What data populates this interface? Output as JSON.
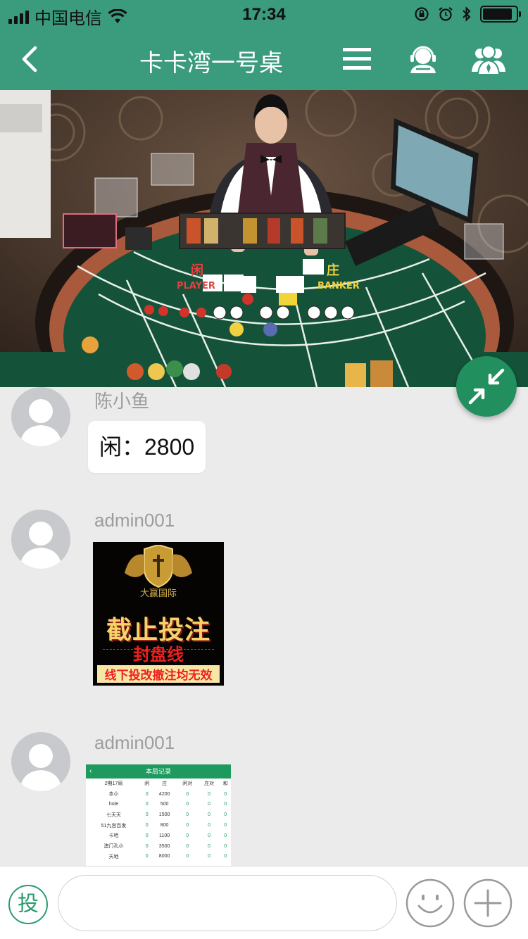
{
  "status_bar": {
    "carrier": "中国电信",
    "time": "17:34",
    "battery_level": 0.9
  },
  "nav": {
    "title": "卡卡湾一号桌",
    "icons": [
      "back-chevron-icon",
      "menu-icon",
      "customer-service-icon",
      "group-members-icon"
    ]
  },
  "video": {
    "table_labels": {
      "player_cn": "闲",
      "player_en": "PLAYER",
      "banker_cn": "庄",
      "banker_en": "BANKER"
    }
  },
  "messages": [
    {
      "sender": "陈小鱼",
      "type": "text",
      "text": "闲：2800"
    },
    {
      "sender": "admin001",
      "type": "image",
      "image": {
        "brand": "大赢国际",
        "headline": "截止投注",
        "subhead": "封盘线",
        "notice": "线下投改撤注均无效"
      }
    },
    {
      "sender": "admin001",
      "type": "image",
      "record": {
        "title": "本局记录",
        "headers": [
          "2期17局",
          "闲",
          "庄",
          "闲对",
          "庄对",
          "和"
        ],
        "rows": [
          [
            "本小",
            "0",
            "4200",
            "0",
            "0",
            "0"
          ],
          [
            "hole",
            "0",
            "500",
            "0",
            "0",
            "0"
          ],
          [
            "七天天",
            "0",
            "1500",
            "0",
            "0",
            "0"
          ],
          [
            "51九宫百发",
            "0",
            "800",
            "0",
            "0",
            "0"
          ],
          [
            "卡哈",
            "0",
            "1100",
            "0",
            "0",
            "0"
          ],
          [
            "澳门孔小",
            "0",
            "3500",
            "0",
            "0",
            "0"
          ],
          [
            "天地",
            "0",
            "8000",
            "0",
            "0",
            "0"
          ]
        ]
      }
    }
  ],
  "input_bar": {
    "bet_label": "投",
    "input_value": "",
    "input_placeholder": "",
    "icons": [
      "emoji-icon",
      "plus-icon"
    ]
  },
  "colors": {
    "header_green": "#3a9b7d",
    "fab_green": "#22905e",
    "chat_background": "#ebebeb"
  }
}
